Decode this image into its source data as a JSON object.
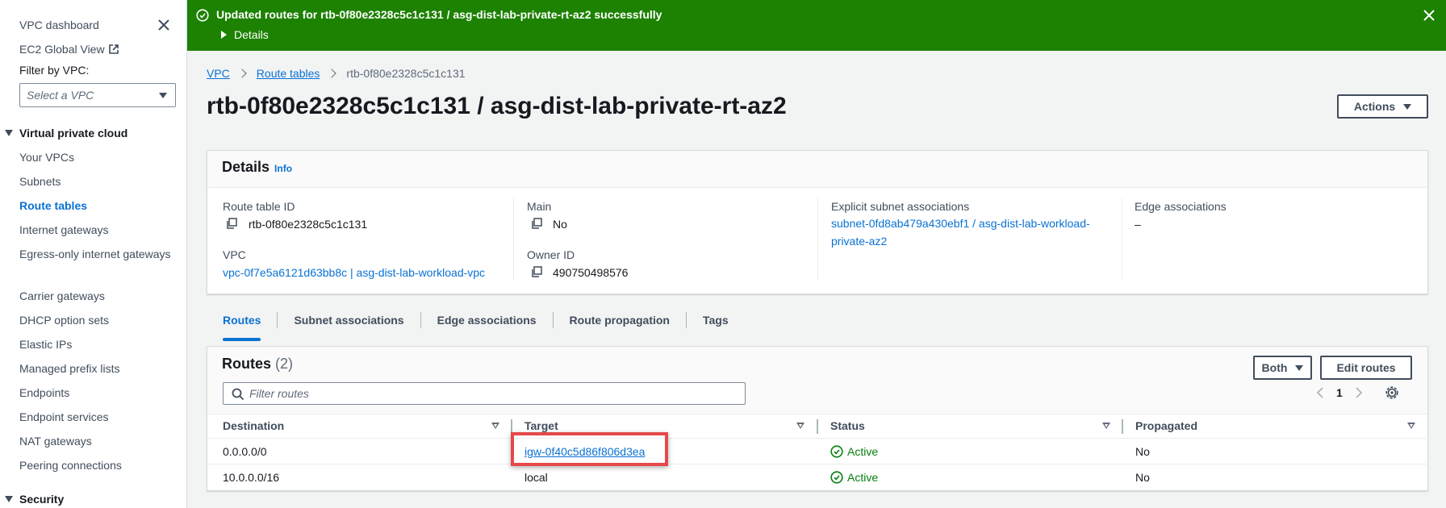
{
  "sidebar": {
    "dashboard": "VPC dashboard",
    "ec2_global_view": "EC2 Global View",
    "filter_label": "Filter by VPC:",
    "filter_placeholder": "Select a VPC",
    "section_vpc": "Virtual private cloud",
    "items": [
      {
        "label": "Your VPCs"
      },
      {
        "label": "Subnets"
      },
      {
        "label": "Route tables",
        "active": true
      },
      {
        "label": "Internet gateways"
      },
      {
        "label": "Egress-only internet gateways"
      },
      {
        "label": "Carrier gateways"
      },
      {
        "label": "DHCP option sets"
      },
      {
        "label": "Elastic IPs"
      },
      {
        "label": "Managed prefix lists"
      },
      {
        "label": "Endpoints"
      },
      {
        "label": "Endpoint services"
      },
      {
        "label": "NAT gateways"
      },
      {
        "label": "Peering connections"
      }
    ],
    "section_security": "Security"
  },
  "flash": {
    "message": "Updated routes for rtb-0f80e2328c5c1c131 / asg-dist-lab-private-rt-az2 successfully",
    "details_label": "Details",
    "color": "#1d8102"
  },
  "breadcrumb": {
    "vpc": "VPC",
    "route_tables": "Route tables",
    "current": "rtb-0f80e2328c5c1c131"
  },
  "page_title": "rtb-0f80e2328c5c1c131 / asg-dist-lab-private-rt-az2",
  "actions_label": "Actions",
  "details": {
    "title": "Details",
    "info": "Info",
    "route_table_id_label": "Route table ID",
    "route_table_id": "rtb-0f80e2328c5c1c131",
    "main_label": "Main",
    "main": "No",
    "explicit_label": "Explicit subnet associations",
    "explicit": "subnet-0fd8ab479a430ebf1 / asg-dist-lab-workload-private-az2",
    "edge_label": "Edge associations",
    "edge": "–",
    "vpc_label": "VPC",
    "vpc": "vpc-0f7e5a6121d63bb8c | asg-dist-lab-workload-vpc",
    "owner_label": "Owner ID",
    "owner": "490750498576"
  },
  "tabs": [
    {
      "label": "Routes",
      "active": true
    },
    {
      "label": "Subnet associations"
    },
    {
      "label": "Edge associations"
    },
    {
      "label": "Route propagation"
    },
    {
      "label": "Tags"
    }
  ],
  "routes": {
    "title": "Routes",
    "count": "(2)",
    "both_label": "Both",
    "edit_label": "Edit routes",
    "search_placeholder": "Filter routes",
    "page": "1",
    "columns": [
      "Destination",
      "Target",
      "Status",
      "Propagated"
    ],
    "rows": [
      {
        "destination": "0.0.0.0/0",
        "target": "igw-0f40c5d86f806d3ea",
        "status": "Active",
        "propagated": "No"
      },
      {
        "destination": "10.0.0.0/16",
        "target": "local",
        "status": "Active",
        "propagated": "No"
      }
    ]
  },
  "colors": {
    "link": "#0972d3",
    "success": "#037f0c",
    "highlight": "#e5494a"
  }
}
